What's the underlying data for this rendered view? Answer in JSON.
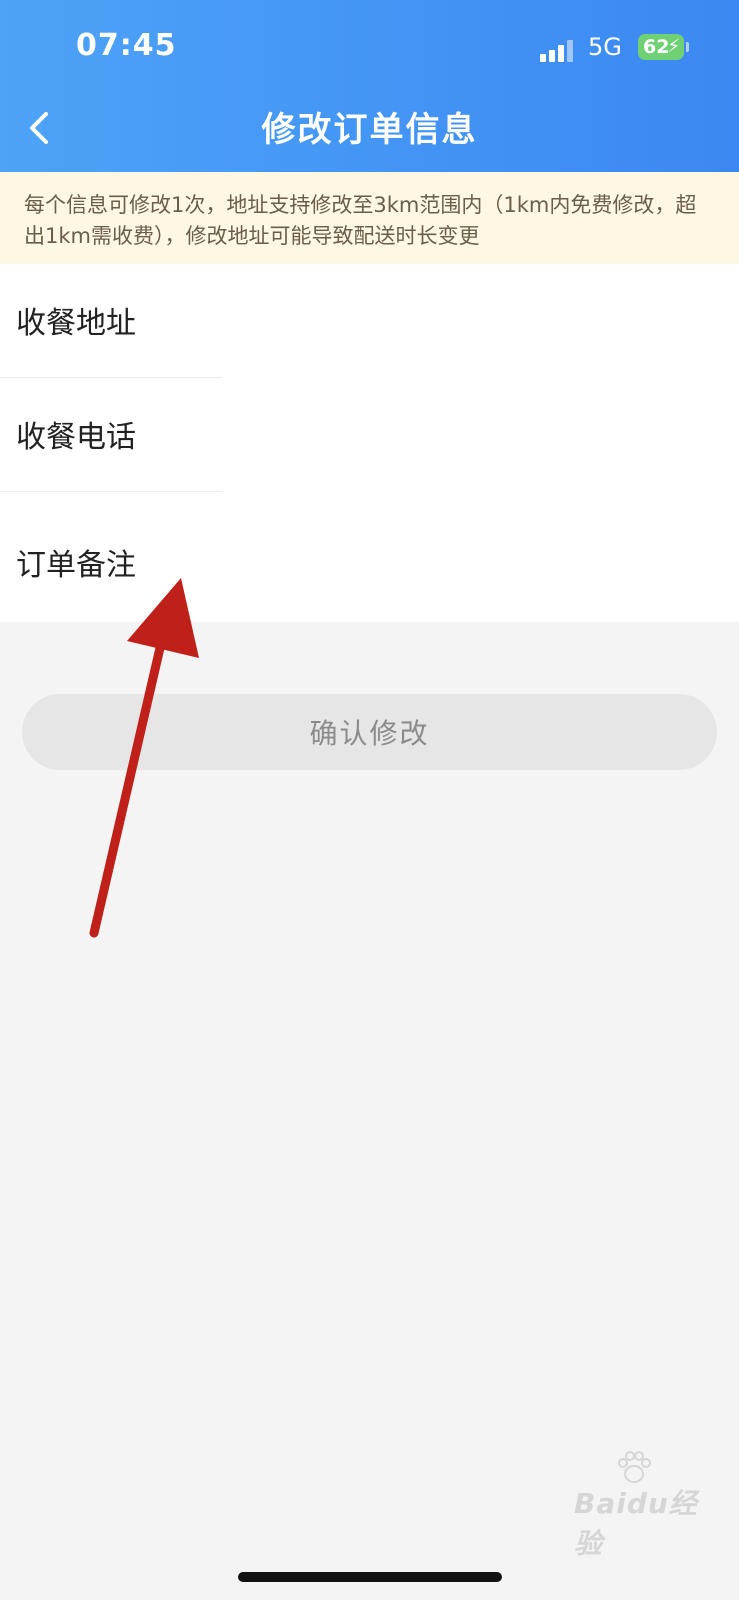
{
  "status_bar": {
    "time": "07:45",
    "network": "5G",
    "battery": "62"
  },
  "header": {
    "title": "修改订单信息",
    "back_icon": "chevron-left-icon",
    "background_color": "#3b88f2"
  },
  "notice": {
    "text": "每个信息可修改1次，地址支持修改至3km范围内（1km内免费修改，超出1km需收费），修改地址可能导致配送时长变更",
    "background_color": "#fdf7e4"
  },
  "rows": [
    {
      "label": "收餐地址"
    },
    {
      "label": "收餐电话"
    },
    {
      "label": "订单备注"
    }
  ],
  "confirm_button": {
    "label": "确认修改",
    "state": "disabled"
  },
  "annotation": {
    "arrow_icon": "red-arrow-icon",
    "color": "#c0201a"
  },
  "watermark": {
    "icon": "baidu-paw-icon",
    "text": "Baidu经验"
  }
}
